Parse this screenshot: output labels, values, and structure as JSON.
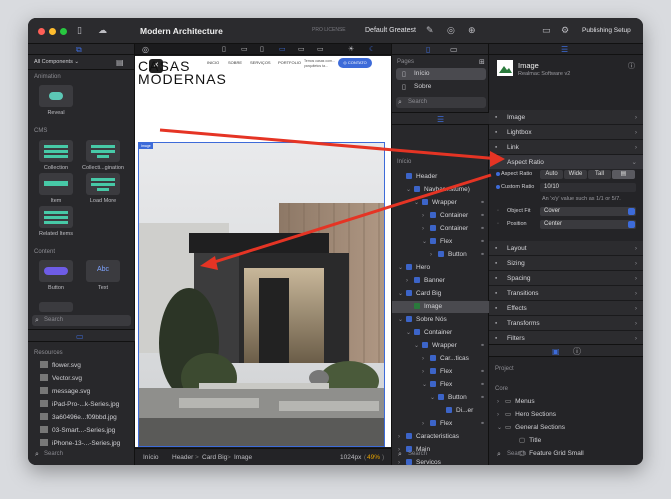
{
  "window": {
    "title": "Modern Architecture"
  },
  "toolbar": {
    "pro_license": "PRO LICENSE",
    "theme": "Default Greatest",
    "publishing": "Publishing Setup"
  },
  "left": {
    "components_select": "All Components",
    "animation_title": "Animation",
    "reveal_label": "Reveal",
    "cms_title": "CMS",
    "cms_items": [
      "Collection",
      "Collecti...gination",
      "Item",
      "Load More",
      "Related Items"
    ],
    "content_title": "Content",
    "content_items": [
      "Button",
      "Text"
    ],
    "search_placeholder": "Search",
    "resources_title": "Resources",
    "resources": [
      "flower.svg",
      "Vector.svg",
      "message.svg",
      "iPad-Pro-...k-Series.jpg",
      "3a60496e...f09bbd.jpg",
      "03-Smart...-Series.jpg",
      "iPhone-13-...-Series.jpg"
    ],
    "search2_placeholder": "Search"
  },
  "canvas": {
    "heading_line1": "CASAS",
    "heading_line2": "MODERNAS",
    "nav": [
      "INICIO",
      "SOBRE",
      "SERVIÇOS",
      "PORTFOLIO"
    ],
    "nav_blurb": "Temos casas com...\nyarquitetos ta...",
    "contact_label": "CONTATO",
    "image_badge": "Image",
    "status_items": [
      "Início",
      "Header",
      "Card Big",
      "Image"
    ],
    "width_readout": "1024px",
    "zoom": "49%"
  },
  "mid": {
    "pages_title": "Pages",
    "pages": [
      "Início",
      "Sobre"
    ],
    "search_placeholder": "Search",
    "tree_root": "Início",
    "tree": [
      {
        "label": "Header",
        "depth": 0,
        "chev": ""
      },
      {
        "label": "Navbar...stume)",
        "depth": 1,
        "chev": "v"
      },
      {
        "label": "Wrapper",
        "depth": 2,
        "chev": "v"
      },
      {
        "label": "Container",
        "depth": 3,
        "chev": ">"
      },
      {
        "label": "Container",
        "depth": 3,
        "chev": ">"
      },
      {
        "label": "Flex",
        "depth": 3,
        "chev": "v"
      },
      {
        "label": "Button",
        "depth": 4,
        "chev": ">"
      },
      {
        "label": "Hero",
        "depth": 0,
        "chev": "v"
      },
      {
        "label": "Banner",
        "depth": 1,
        "chev": ">"
      },
      {
        "label": "Card Big",
        "depth": 0,
        "chev": "v"
      },
      {
        "label": "Image",
        "depth": 1,
        "chev": ""
      },
      {
        "label": "Sobre Nós",
        "depth": 0,
        "chev": "v"
      },
      {
        "label": "Container",
        "depth": 1,
        "chev": "v"
      },
      {
        "label": "Wrapper",
        "depth": 2,
        "chev": "v"
      },
      {
        "label": "Car...ticas",
        "depth": 3,
        "chev": ">"
      },
      {
        "label": "Flex",
        "depth": 3,
        "chev": ">"
      },
      {
        "label": "Flex",
        "depth": 3,
        "chev": "v"
      },
      {
        "label": "Button",
        "depth": 4,
        "chev": "v"
      },
      {
        "label": "Di...er",
        "depth": 5,
        "chev": ""
      },
      {
        "label": "Flex",
        "depth": 3,
        "chev": ">"
      },
      {
        "label": "Caracteristicas",
        "depth": 0,
        "chev": ">"
      },
      {
        "label": "Main",
        "depth": 0,
        "chev": ">"
      },
      {
        "label": "Servicos",
        "depth": 0,
        "chev": ">"
      }
    ],
    "search2_placeholder": "Search"
  },
  "right": {
    "component_name": "Image",
    "component_vendor": "Realmac Software",
    "component_version": "v2",
    "groups_top": [
      "Image",
      "Lightbox",
      "Link",
      "Aspect Ratio"
    ],
    "aspect_label": "Aspect Ratio",
    "aspect_options": [
      "Auto",
      "Wide",
      "Tall"
    ],
    "custom_ratio_label": "Custom Ratio",
    "custom_ratio_value": "10/10",
    "hint": "An 'x/y' value such as 1/1 or 5/7.",
    "object_fit_label": "Object Fit",
    "object_fit_value": "Cover",
    "position_label": "Position",
    "position_value": "Center",
    "groups_bottom": [
      "Layout",
      "Sizing",
      "Spacing",
      "Transitions",
      "Effects",
      "Transforms",
      "Filters"
    ],
    "project_title": "Project",
    "core_title": "Core",
    "project_tree": [
      "Menus",
      "Hero Sections",
      "General Sections",
      "Title",
      "Feature Grid Small"
    ],
    "search_placeholder": "Search"
  },
  "colors": {
    "accent": "#3d6bd9",
    "arrow": "#e53424"
  }
}
